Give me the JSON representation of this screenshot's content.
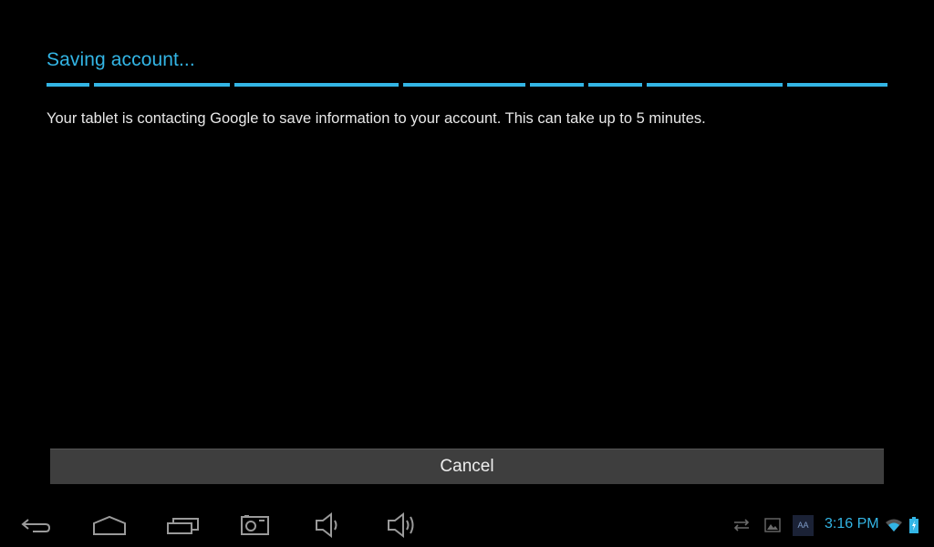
{
  "dialog": {
    "title": "Saving account...",
    "message": "Your tablet is contacting Google to save information to your account. This can take up to 5 minutes.",
    "progress": {
      "state": "indeterminate",
      "segment_count": 8,
      "color": "#33b5e5"
    },
    "cancel_label": "Cancel"
  },
  "navbar": {
    "buttons": [
      {
        "name": "back",
        "icon": "back-icon"
      },
      {
        "name": "home",
        "icon": "home-icon"
      },
      {
        "name": "recent-apps",
        "icon": "recent-apps-icon"
      },
      {
        "name": "screenshot",
        "icon": "camera-icon"
      },
      {
        "name": "volume-down",
        "icon": "volume-down-icon"
      },
      {
        "name": "volume-up",
        "icon": "volume-up-icon"
      }
    ]
  },
  "status": {
    "icons": [
      "sync-icon",
      "gallery-icon",
      "keyboard-aa-icon",
      "wifi-icon",
      "battery-charging-icon"
    ],
    "keyboard_label": "AA",
    "time": "3:16 PM",
    "accent": "#33b5e5"
  }
}
